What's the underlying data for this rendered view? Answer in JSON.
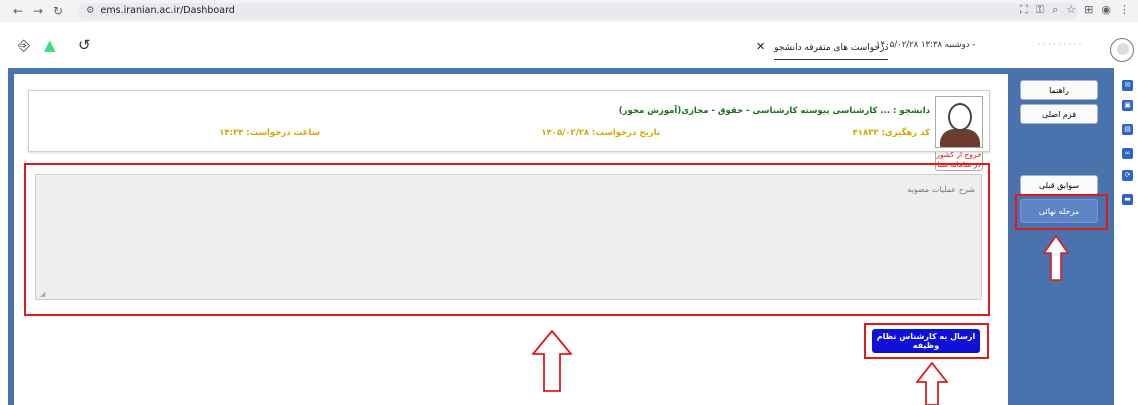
{
  "browser": {
    "url": "ems.iranian.ac.ir/Dashboard"
  },
  "header": {
    "tab_title": "درخواست های متفرقه دانشجو",
    "tab_close": "✕",
    "datetime": "۱۴۰۵/۰۲/۲۸ دوشنبه ۱۳:۳۸ -"
  },
  "menu": {
    "guide": "راهنما",
    "main_form": "فرم اصلی",
    "exit_photo": "تصویر درخواست خروج از کشور در سامانه سنا نیروی انتظامی",
    "history": "سوابق قبلی",
    "final_stage": "مرحله نهائی"
  },
  "card": {
    "student": "دانشجو : ... کارشناسی پیوسته کارشناسی - حقوق - مجازی(آموزش محور)",
    "tracking_code": "کد رهگیری: ۴۱۸۳۳",
    "request_date": "تاریخ درخواست: ۱۴۰۵/۰۲/۲۸",
    "request_time": "ساعت درخواست: ۱۴:۳۴"
  },
  "form": {
    "desc_placeholder": "شرح عملیات مصوبه",
    "submit": "ارسال به کارشناس نظام وظیفه"
  },
  "colors": {
    "frame": "#4a73ad",
    "annotation": "#e0191d",
    "submit": "#1010d8"
  }
}
